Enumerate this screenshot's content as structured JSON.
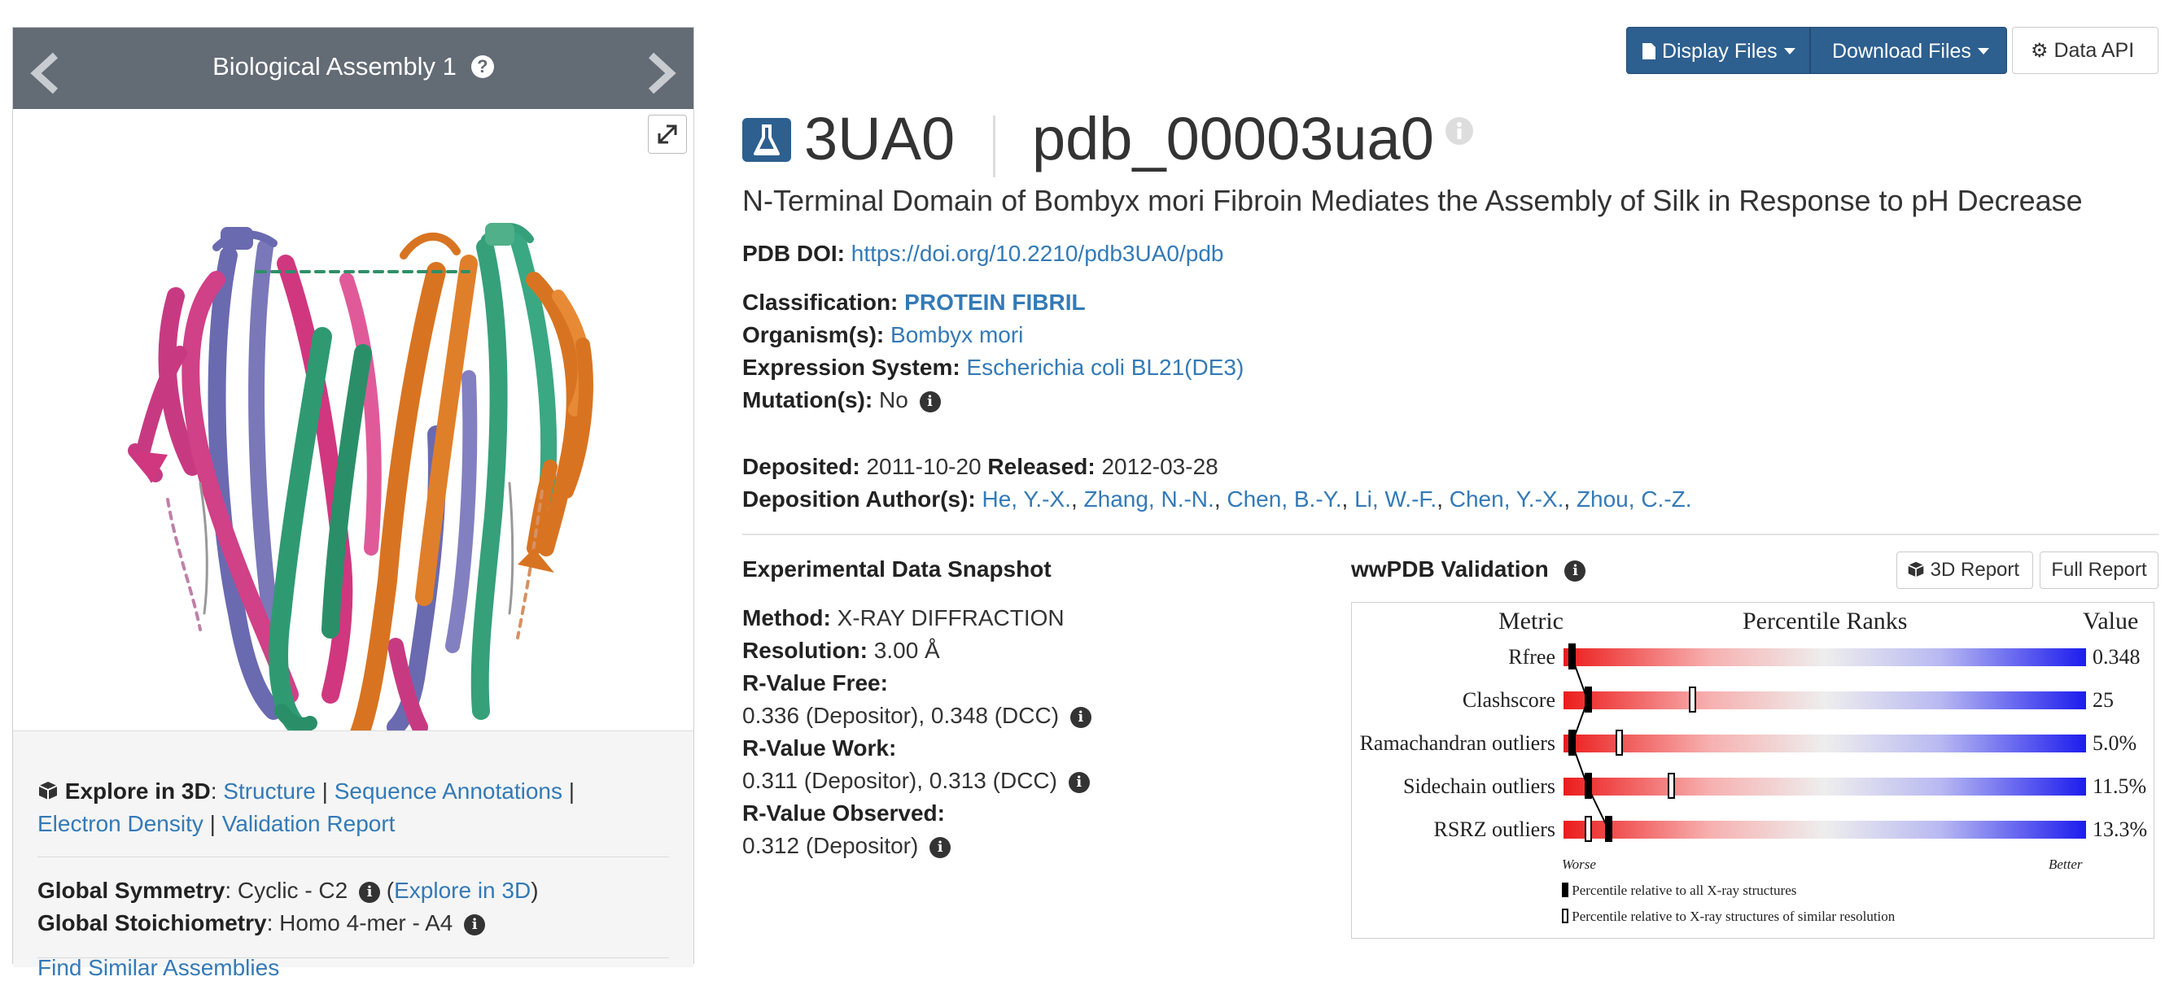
{
  "carousel": {
    "title": "Biological Assembly 1",
    "help_icon": "question-circle-icon",
    "prev_icon": "chevron-left-icon",
    "next_icon": "chevron-right-icon",
    "expand_icon": "expand-icon"
  },
  "explore": {
    "label": "Explore in 3D",
    "links": [
      "Structure",
      "Sequence Annotations",
      "Electron Density",
      "Validation Report"
    ],
    "sep": "|",
    "symmetry_label": "Global Symmetry",
    "symmetry_value": "Cyclic - C2",
    "symmetry_link": "Explore in 3D",
    "stoich_label": "Global Stoichiometry",
    "stoich_value": "Homo 4-mer - A4",
    "find_similar": "Find Similar Assemblies"
  },
  "toolbar": {
    "display_files": "Display Files",
    "download_files": "Download Files",
    "data_api": "Data API"
  },
  "entry": {
    "id": "3UA0",
    "ext_id": "pdb_00003ua0",
    "title": "N-Terminal Domain of Bombyx mori Fibroin Mediates the Assembly of Silk in Response to pH Decrease",
    "doi_label": "PDB DOI:",
    "doi": "https://doi.org/10.2210/pdb3UA0/pdb",
    "classification_label": "Classification:",
    "classification": "PROTEIN FIBRIL",
    "organism_label": "Organism(s):",
    "organism": "Bombyx mori",
    "expression_label": "Expression System:",
    "expression": "Escherichia coli BL21(DE3)",
    "mutation_label": "Mutation(s):",
    "mutation": "No",
    "deposited_label": "Deposited:",
    "deposited": "2011-10-20",
    "released_label": "Released:",
    "released": "2012-03-28",
    "authors_label": "Deposition Author(s):",
    "authors": [
      "He, Y.-X.",
      "Zhang, N.-N.",
      "Chen, B.-Y.",
      "Li, W.-F.",
      "Chen, Y.-X.",
      "Zhou, C.-Z."
    ]
  },
  "snapshot": {
    "heading": "Experimental Data Snapshot",
    "method_label": "Method:",
    "method": "X-RAY DIFFRACTION",
    "resolution_label": "Resolution:",
    "resolution": "3.00 Å",
    "rfree_label": "R-Value Free:",
    "rfree": "0.336 (Depositor), 0.348 (DCC)",
    "rwork_label": "R-Value Work:",
    "rwork": "0.311 (Depositor), 0.313 (DCC)",
    "robs_label": "R-Value Observed:",
    "robs": "0.312 (Depositor)"
  },
  "validation": {
    "heading": "wwPDB Validation",
    "report_3d": "3D Report",
    "full_report": "Full Report",
    "col_metric": "Metric",
    "col_ranks": "Percentile Ranks",
    "col_value": "Value",
    "worse": "Worse",
    "better": "Better",
    "legend_all": "Percentile relative to all X-ray structures",
    "legend_similar": "Percentile relative to X-ray structures of similar resolution",
    "metrics": [
      {
        "name": "Rfree",
        "value": "0.348",
        "pct_all": 0.01,
        "pct_similar": 0.01
      },
      {
        "name": "Clashscore",
        "value": "25",
        "pct_all": 0.04,
        "pct_similar": 0.24
      },
      {
        "name": "Ramachandran outliers",
        "value": "5.0%",
        "pct_all": 0.01,
        "pct_similar": 0.1
      },
      {
        "name": "Sidechain outliers",
        "value": "11.5%",
        "pct_all": 0.04,
        "pct_similar": 0.2
      },
      {
        "name": "RSRZ outliers",
        "value": "13.3%",
        "pct_all": 0.08,
        "pct_similar": 0.04
      }
    ]
  }
}
